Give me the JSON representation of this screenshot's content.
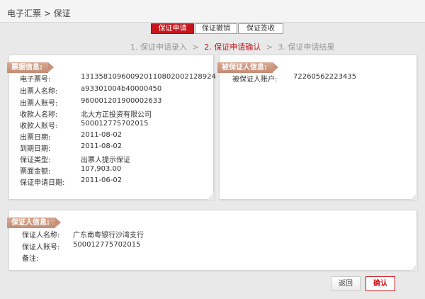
{
  "breadcrumb": "电子汇票 > 保证",
  "tabs": [
    {
      "label": "保证申请"
    },
    {
      "label": "保证撤销"
    },
    {
      "label": "保证签收"
    }
  ],
  "steps": {
    "step1": "1. 保证申请录入",
    "step2": "2. 保证申请确认",
    "step3": "3. 保证申请结果",
    "separator": ">"
  },
  "bill_panel": {
    "title": "票据信息:",
    "rows": [
      {
        "label": "电子票号:",
        "value": "131358109600920110802002128924"
      },
      {
        "label": "出票人名称:",
        "value": "a93301004b40000450"
      },
      {
        "label": "出票人账号:",
        "value": "960001201900002633"
      },
      {
        "label": "收款人名称:",
        "value": "北大方正投资有限公司"
      },
      {
        "label": "收款人账号:",
        "value": "500012775702015"
      },
      {
        "label": "出票日期:",
        "value": "2011-08-02"
      },
      {
        "label": "到期日期:",
        "value": "2011-08-02"
      },
      {
        "label": "保证类型:",
        "value": "出票人提示保证"
      },
      {
        "label": "票面金额:",
        "value": "107,903.00"
      },
      {
        "label": "保证申请日期:",
        "value": "2011-06-02"
      }
    ]
  },
  "payee_panel": {
    "title": "被保证人信息:",
    "rows": [
      {
        "label": "被保证人账户:",
        "value": "72260562223435"
      }
    ]
  },
  "guarantor_panel": {
    "title": "保证人信息:",
    "rows": [
      {
        "label": "保证人名称:",
        "value": "广东南粤银行沙湾支行"
      },
      {
        "label": "保证人账号:",
        "value": "500012775702015"
      },
      {
        "label": "备注:",
        "value": ""
      }
    ]
  },
  "buttons": {
    "back": "返回",
    "confirm": "确认"
  },
  "colors": {
    "accent": "#c8161d",
    "title_tag": "#c9917a"
  }
}
